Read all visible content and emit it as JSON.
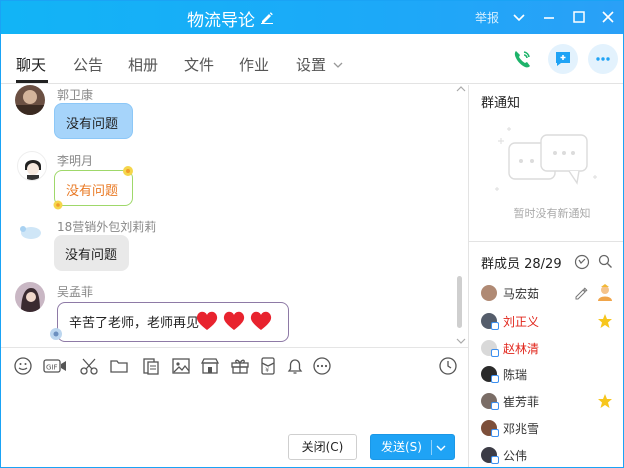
{
  "window": {
    "title": "物流导论",
    "report_label": "举报",
    "colors": {
      "accent": "#1fa3f5",
      "title_bar": "#18acf7",
      "red_name": "#e1251b"
    }
  },
  "tabs": [
    {
      "label": "聊天",
      "active": true
    },
    {
      "label": "公告"
    },
    {
      "label": "相册"
    },
    {
      "label": "文件"
    },
    {
      "label": "作业"
    },
    {
      "label": "设置"
    }
  ],
  "chat": {
    "messages": [
      {
        "sender": "郭卫康",
        "text": "没有问题"
      },
      {
        "sender": "李明月",
        "text": "没有问题"
      },
      {
        "sender": "18营销外包刘莉莉",
        "text": "没有问题"
      },
      {
        "sender": "吴孟菲",
        "text": "辛苦了老师，老师再见"
      }
    ]
  },
  "toolbar": {
    "icons": [
      "emoji-icon",
      "gif-icon",
      "scissors-icon",
      "folder-icon",
      "document-icon",
      "image-icon",
      "shop-icon",
      "gift-icon",
      "red-packet-icon",
      "bell-icon",
      "more-icon",
      "history-icon"
    ],
    "close_label": "关闭(C)",
    "send_label": "发送(S)"
  },
  "notice": {
    "title": "群通知",
    "empty_text": "暂时没有新通知"
  },
  "members": {
    "title": "群成员 28/29",
    "list": [
      {
        "name": "马宏茹",
        "role": "owner"
      },
      {
        "name": "刘正义",
        "highlight": true,
        "star": true
      },
      {
        "name": "赵林清",
        "highlight": true
      },
      {
        "name": "陈瑞"
      },
      {
        "name": "崔芳菲",
        "star": true
      },
      {
        "name": "邓兆雪"
      },
      {
        "name": "公伟"
      }
    ]
  }
}
